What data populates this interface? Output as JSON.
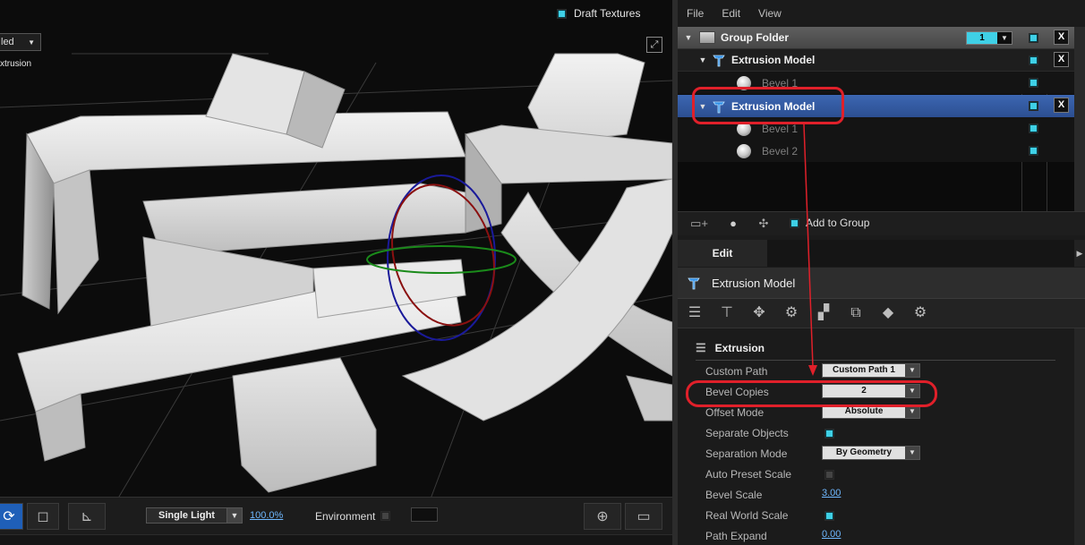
{
  "viewport": {
    "draft_textures_label": "Draft Textures",
    "shading_value": "led",
    "shading_arrow": "▼",
    "extrusion_label": "xtrusion",
    "maximize_glyph": "⤢",
    "toolbar": {
      "rotate_glyph": "⟳",
      "frame_glyph": "◻",
      "axes_glyph": "⊾",
      "lighting_value": "Single Light",
      "lighting_arrow": "▼",
      "zoom_value": "100.0%",
      "environment_label": "Environment",
      "target_glyph": "⊕",
      "monitor_glyph": "▭"
    }
  },
  "menubar": {
    "items": [
      "File",
      "Edit",
      "View"
    ]
  },
  "tree": {
    "rows": [
      {
        "label": "Group Folder",
        "type": "folder",
        "layer_value": "1",
        "layer_arrow": "▼"
      },
      {
        "label": "Extrusion Model",
        "type": "model"
      },
      {
        "label": "Bevel 1",
        "type": "bevel"
      },
      {
        "label": "Extrusion Model",
        "type": "model-selected"
      },
      {
        "label": "Bevel 1",
        "type": "bevel"
      },
      {
        "label": "Bevel 2",
        "type": "bevel"
      }
    ],
    "expand_glyph": "▼",
    "delete_glyph": "X",
    "toolbar": {
      "add_to_group_label": "Add to Group",
      "new_folder_glyph": "▭+",
      "sphere_glyph": "●",
      "shader_glyph": "✣"
    }
  },
  "edit": {
    "tab_label": "Edit",
    "tab_arrow": "▶",
    "model_title": "Extrusion Model",
    "tool_glyphs": [
      "☰",
      "⊤",
      "✥",
      "⚙",
      "▞",
      "⧉",
      "◆",
      "⚙"
    ],
    "section_title": "Extrusion",
    "properties": [
      {
        "label": "Custom Path",
        "kind": "dropdown",
        "value": "Custom Path 1"
      },
      {
        "label": "Bevel Copies",
        "kind": "dropdown",
        "value": "2"
      },
      {
        "label": "Offset Mode",
        "kind": "dropdown",
        "value": "Absolute"
      },
      {
        "label": "Separate Objects",
        "kind": "checkbox",
        "checked": true
      },
      {
        "label": "Separation Mode",
        "kind": "dropdown",
        "value": "By Geometry"
      },
      {
        "label": "Auto Preset Scale",
        "kind": "checkbox",
        "checked": false
      },
      {
        "label": "Bevel Scale",
        "kind": "number",
        "value": "3.00"
      },
      {
        "label": "Real World Scale",
        "kind": "checkbox",
        "checked": true
      },
      {
        "label": "Path Expand",
        "kind": "number",
        "value": "0.00"
      }
    ],
    "dropdown_arrow": "▼"
  },
  "colors": {
    "accent": "#3fd0e6",
    "selection": "#2f56a0",
    "annotation": "#e0202a",
    "link": "#6fb8ff"
  }
}
